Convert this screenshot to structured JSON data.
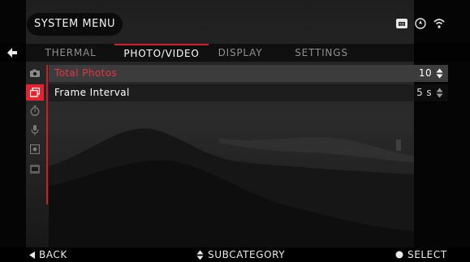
{
  "header": {
    "menu_title": "SYSTEM MENU"
  },
  "status_icons": [
    "sd-card-icon",
    "compass-icon",
    "wifi-icon"
  ],
  "tabs": [
    {
      "label": "THERMAL",
      "active": false
    },
    {
      "label": "PHOTO/VIDEO",
      "active": true
    },
    {
      "label": "DISPLAY",
      "active": false
    },
    {
      "label": "SETTINGS",
      "active": false
    }
  ],
  "side_icons": [
    "camera-icon",
    "photo-stack-icon",
    "timer-icon",
    "microphone-icon",
    "video-settings-icon",
    "sd-card-icon"
  ],
  "rows": [
    {
      "label": "Total Photos",
      "value": "10",
      "selected": true
    },
    {
      "label": "Frame Interval",
      "value": "5 s",
      "selected": false
    }
  ],
  "footer": {
    "back": "BACK",
    "subcategory": "SUBCATEGORY",
    "select": "SELECT"
  },
  "colors": {
    "accent": "#e4242f",
    "selected_row": "#3c3c3c"
  }
}
